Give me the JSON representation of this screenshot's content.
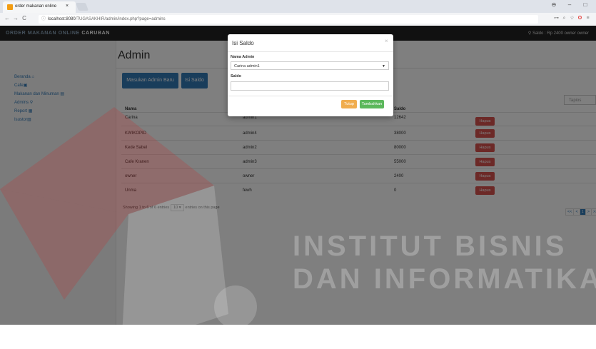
{
  "browser": {
    "tab_title": "order makanan online",
    "tab_close": "×",
    "url_host": "localhost:8080",
    "url_path": "/TUGASAKHIR/admin/index.php?page=admins",
    "window_controls": [
      "⊖",
      "–",
      "□"
    ],
    "nav_icons": [
      "back-icon",
      "forward-icon",
      "refresh-icon"
    ],
    "ext_icons": [
      "key-icon",
      "zoom-icon",
      "star-icon",
      "opera-icon",
      "menu-icon"
    ]
  },
  "navbar": {
    "brand_main": "ORDER MAKANAN ONLINE",
    "brand_sub": "CARUBAN",
    "saldo_text": "Saldo : Rp 2400 owner owner"
  },
  "sidebar": {
    "items": [
      {
        "label": "Beranda"
      },
      {
        "label": "Cafe"
      },
      {
        "label": "Makanan dan Minuman"
      },
      {
        "label": "Admins"
      },
      {
        "label": "Report"
      },
      {
        "label": "Isustor"
      }
    ]
  },
  "main": {
    "title": "Admin",
    "btn_add": "Masukan Admin Baru",
    "btn_isi": "Isi Saldo",
    "search_placeholder": "Tapios",
    "headers": [
      "Nama",
      "",
      "Saldo"
    ],
    "rows": [
      {
        "nama": "Carina",
        "tipe": "admin1",
        "saldo": "12642",
        "action": "Hapus"
      },
      {
        "nama": "KWIKOPID",
        "tipe": "admin4",
        "saldo": "38000",
        "action": "Hapus"
      },
      {
        "nama": "Kede Sabel",
        "tipe": "admin2",
        "saldo": "80000",
        "action": "Hapus"
      },
      {
        "nama": "Cafe Kranen",
        "tipe": "admin3",
        "saldo": "55000",
        "action": "Hapus"
      },
      {
        "nama": "owner",
        "tipe": "owner",
        "saldo": "2400",
        "action": "Hapus"
      },
      {
        "nama": "Unma",
        "tipe": "fewh",
        "saldo": "0",
        "action": "Hapus"
      }
    ],
    "info_prefix": "Showing 1 to 6 of 6 entries",
    "page_size": "10",
    "info_suffix": "entries on this page",
    "pagination": [
      "<<",
      "<",
      "1",
      ">",
      ">>"
    ]
  },
  "modal": {
    "title": "Isi Saldo",
    "close": "×",
    "label_nama": "Nama Admin",
    "select_value": "Carina admin1",
    "label_saldo": "Saldo",
    "btn_tutup": "Tutup",
    "btn_tambah": "Tambahkan"
  },
  "watermark": {
    "line1": "INSTITUT BISNIS",
    "line2": "DAN INFORMATIKA"
  },
  "colors": {
    "primary": "#337ab7",
    "danger": "#d9534f",
    "warning": "#f0ad4e",
    "success": "#5cb85c",
    "navbar": "#222222"
  }
}
